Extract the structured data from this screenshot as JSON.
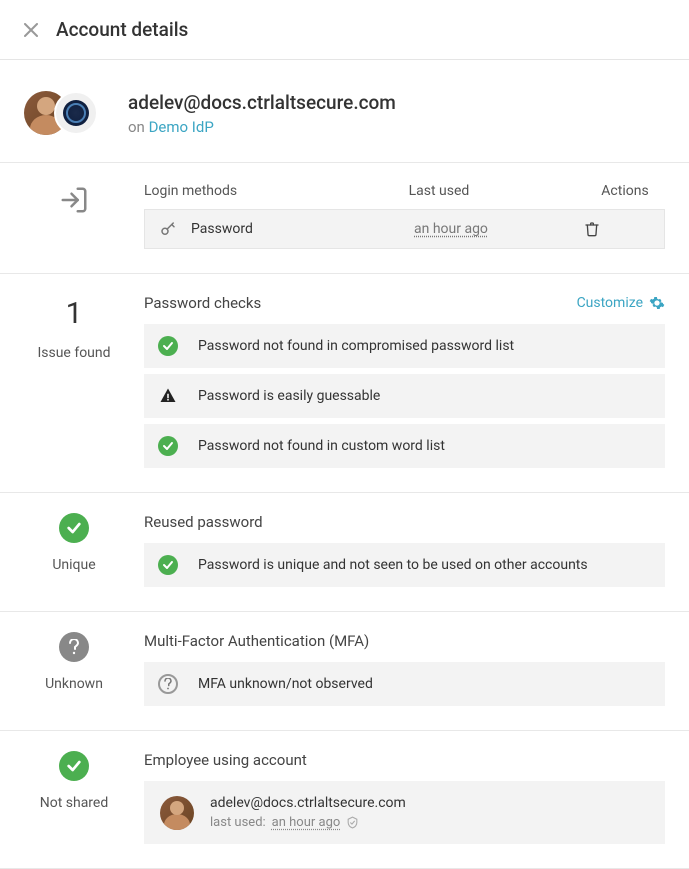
{
  "header": {
    "title": "Account details"
  },
  "account": {
    "email": "adelev@docs.ctrlaltsecure.com",
    "on_prefix": "on ",
    "idp_name": "Demo IdP"
  },
  "login_methods": {
    "header_method": "Login methods",
    "header_lastused": "Last used",
    "header_actions": "Actions",
    "rows": [
      {
        "method": "Password",
        "last_used": "an hour ago"
      }
    ]
  },
  "password_checks": {
    "count": "1",
    "count_label": "Issue found",
    "title": "Password checks",
    "customize_label": "Customize",
    "items": [
      {
        "status": "ok",
        "text": "Password not found in compromised password list"
      },
      {
        "status": "warn",
        "text": "Password is easily guessable"
      },
      {
        "status": "ok",
        "text": "Password not found in custom word list"
      }
    ]
  },
  "reused": {
    "badge_label": "Unique",
    "title": "Reused password",
    "text": "Password is unique and not seen to be used on other accounts"
  },
  "mfa": {
    "badge_label": "Unknown",
    "title": "Multi-Factor Authentication (MFA)",
    "text": "MFA unknown/not observed"
  },
  "employee": {
    "badge_label": "Not shared",
    "title": "Employee using account",
    "email": "adelev@docs.ctrlaltsecure.com",
    "last_used_label": "last used:",
    "last_used_value": "an hour ago"
  }
}
